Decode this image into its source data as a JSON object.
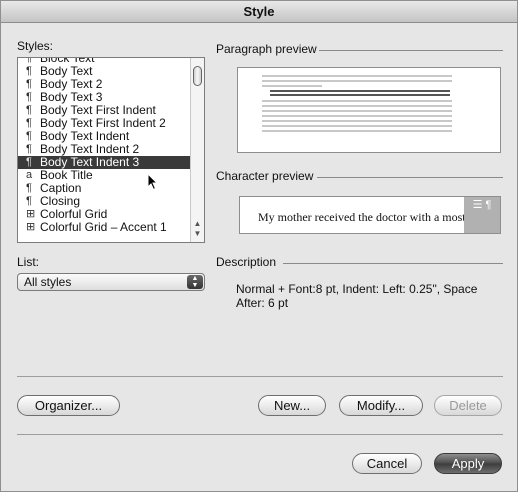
{
  "window": {
    "title": "Style"
  },
  "styles_section": {
    "label": "Styles:",
    "items": [
      {
        "glyph": "¶",
        "label": "Block Text",
        "selected": false
      },
      {
        "glyph": "¶",
        "label": "Body Text",
        "selected": false
      },
      {
        "glyph": "¶",
        "label": "Body Text 2",
        "selected": false
      },
      {
        "glyph": "¶",
        "label": "Body Text 3",
        "selected": false
      },
      {
        "glyph": "¶",
        "label": "Body Text First Indent",
        "selected": false
      },
      {
        "glyph": "¶",
        "label": "Body Text First Indent 2",
        "selected": false
      },
      {
        "glyph": "¶",
        "label": "Body Text Indent",
        "selected": false
      },
      {
        "glyph": "¶",
        "label": "Body Text Indent 2",
        "selected": false
      },
      {
        "glyph": "¶",
        "label": "Body Text Indent 3",
        "selected": true
      },
      {
        "glyph": "a",
        "label": "Book Title",
        "selected": false
      },
      {
        "glyph": "¶",
        "label": "Caption",
        "selected": false
      },
      {
        "glyph": "¶",
        "label": "Closing",
        "selected": false
      },
      {
        "glyph": "⊞",
        "label": "Colorful Grid",
        "selected": false
      },
      {
        "glyph": "⊞",
        "label": "Colorful Grid – Accent 1",
        "selected": false
      }
    ]
  },
  "paragraph_preview": {
    "label": "Paragraph preview"
  },
  "character_preview": {
    "label": "Character preview",
    "sample": "My mother received the doctor with a most friendly"
  },
  "list": {
    "label": "List:",
    "selected": "All styles"
  },
  "description": {
    "label": "Description",
    "text": "Normal + Font:8 pt, Indent: Left:  0.25\", Space After:  6 pt"
  },
  "buttons": {
    "organizer": "Organizer...",
    "new": "New...",
    "modify": "Modify...",
    "delete": "Delete",
    "cancel": "Cancel",
    "apply": "Apply"
  }
}
